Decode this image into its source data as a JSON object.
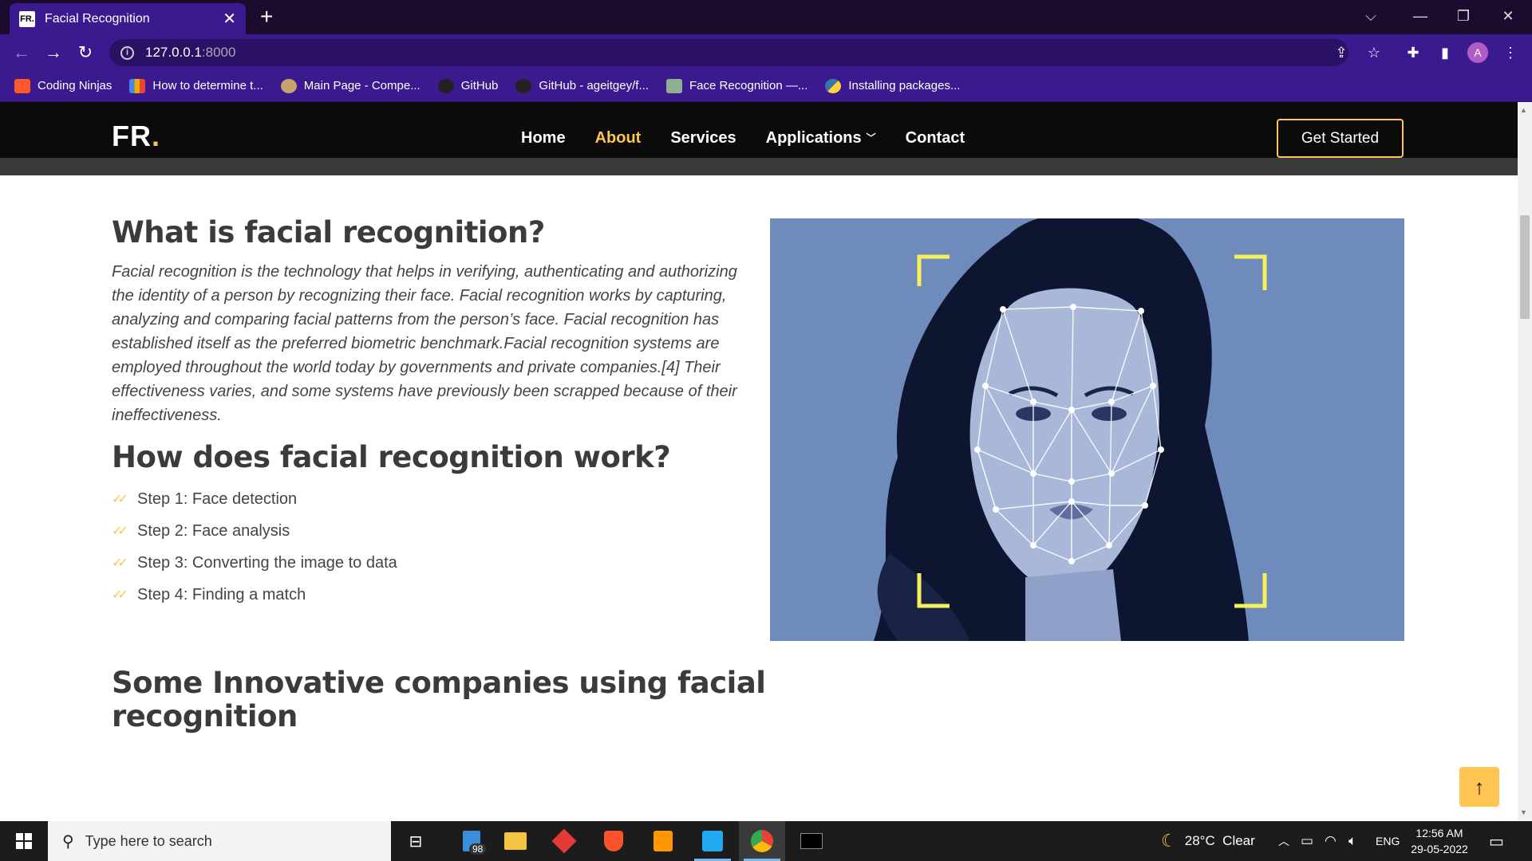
{
  "browser": {
    "tab_title": "Facial Recognition",
    "tab_favicon_text": "FR.",
    "url_host": "127.0.0.1",
    "url_port": ":8000",
    "bookmarks": [
      {
        "label": "Coding Ninjas",
        "icon": "coding-ninjas-icon",
        "color": "#ff5a2c"
      },
      {
        "label": "How to determine t...",
        "icon": "bar-chart-icon",
        "color": "#f2a900"
      },
      {
        "label": "Main Page - Compe...",
        "icon": "wiki-icon",
        "color": "#c8a26b"
      },
      {
        "label": "GitHub",
        "icon": "github-icon",
        "color": "#222222"
      },
      {
        "label": "GitHub - ageitgey/f...",
        "icon": "github-icon",
        "color": "#222222"
      },
      {
        "label": "Face Recognition —...",
        "icon": "docs-icon",
        "color": "#8fb08c"
      },
      {
        "label": "Installing packages...",
        "icon": "python-icon",
        "color": "#3776ab"
      }
    ]
  },
  "site": {
    "logo_text": "FR",
    "logo_dot": ".",
    "nav": [
      {
        "label": "Home",
        "active": false
      },
      {
        "label": "About",
        "active": true
      },
      {
        "label": "Services",
        "active": false
      },
      {
        "label": "Applications",
        "active": false,
        "dropdown": true
      },
      {
        "label": "Contact",
        "active": false
      }
    ],
    "cta": "Get Started",
    "accent_color": "#ffc451"
  },
  "content": {
    "heading1": "What is facial recognition?",
    "paragraph": "Facial recognition is the technology that helps in verifying, authenticating and authorizing the identity of a person by recognizing their face. Facial recognition works by capturing, analyzing and comparing facial patterns from the person’s face. Facial recognition has established itself as the preferred biometric benchmark.Facial recognition systems are employed throughout the world today by governments and private companies.[4] Their effectiveness varies, and some systems have previously been scrapped because of their ineffectiveness.",
    "heading2": "How does facial recognition work?",
    "steps": [
      "Step 1: Face detection",
      "Step 2: Face analysis",
      "Step 3: Converting the image to data",
      "Step 4: Finding a match"
    ],
    "heading3_line1": "Some Innovative companies using facial",
    "heading3_line2": "recognition"
  },
  "taskbar": {
    "search_placeholder": "Type here to search",
    "store_badge": "98",
    "weather": "28°C  Clear",
    "language": "ENG",
    "time": "12:56 AM",
    "date": "29-05-2022"
  }
}
